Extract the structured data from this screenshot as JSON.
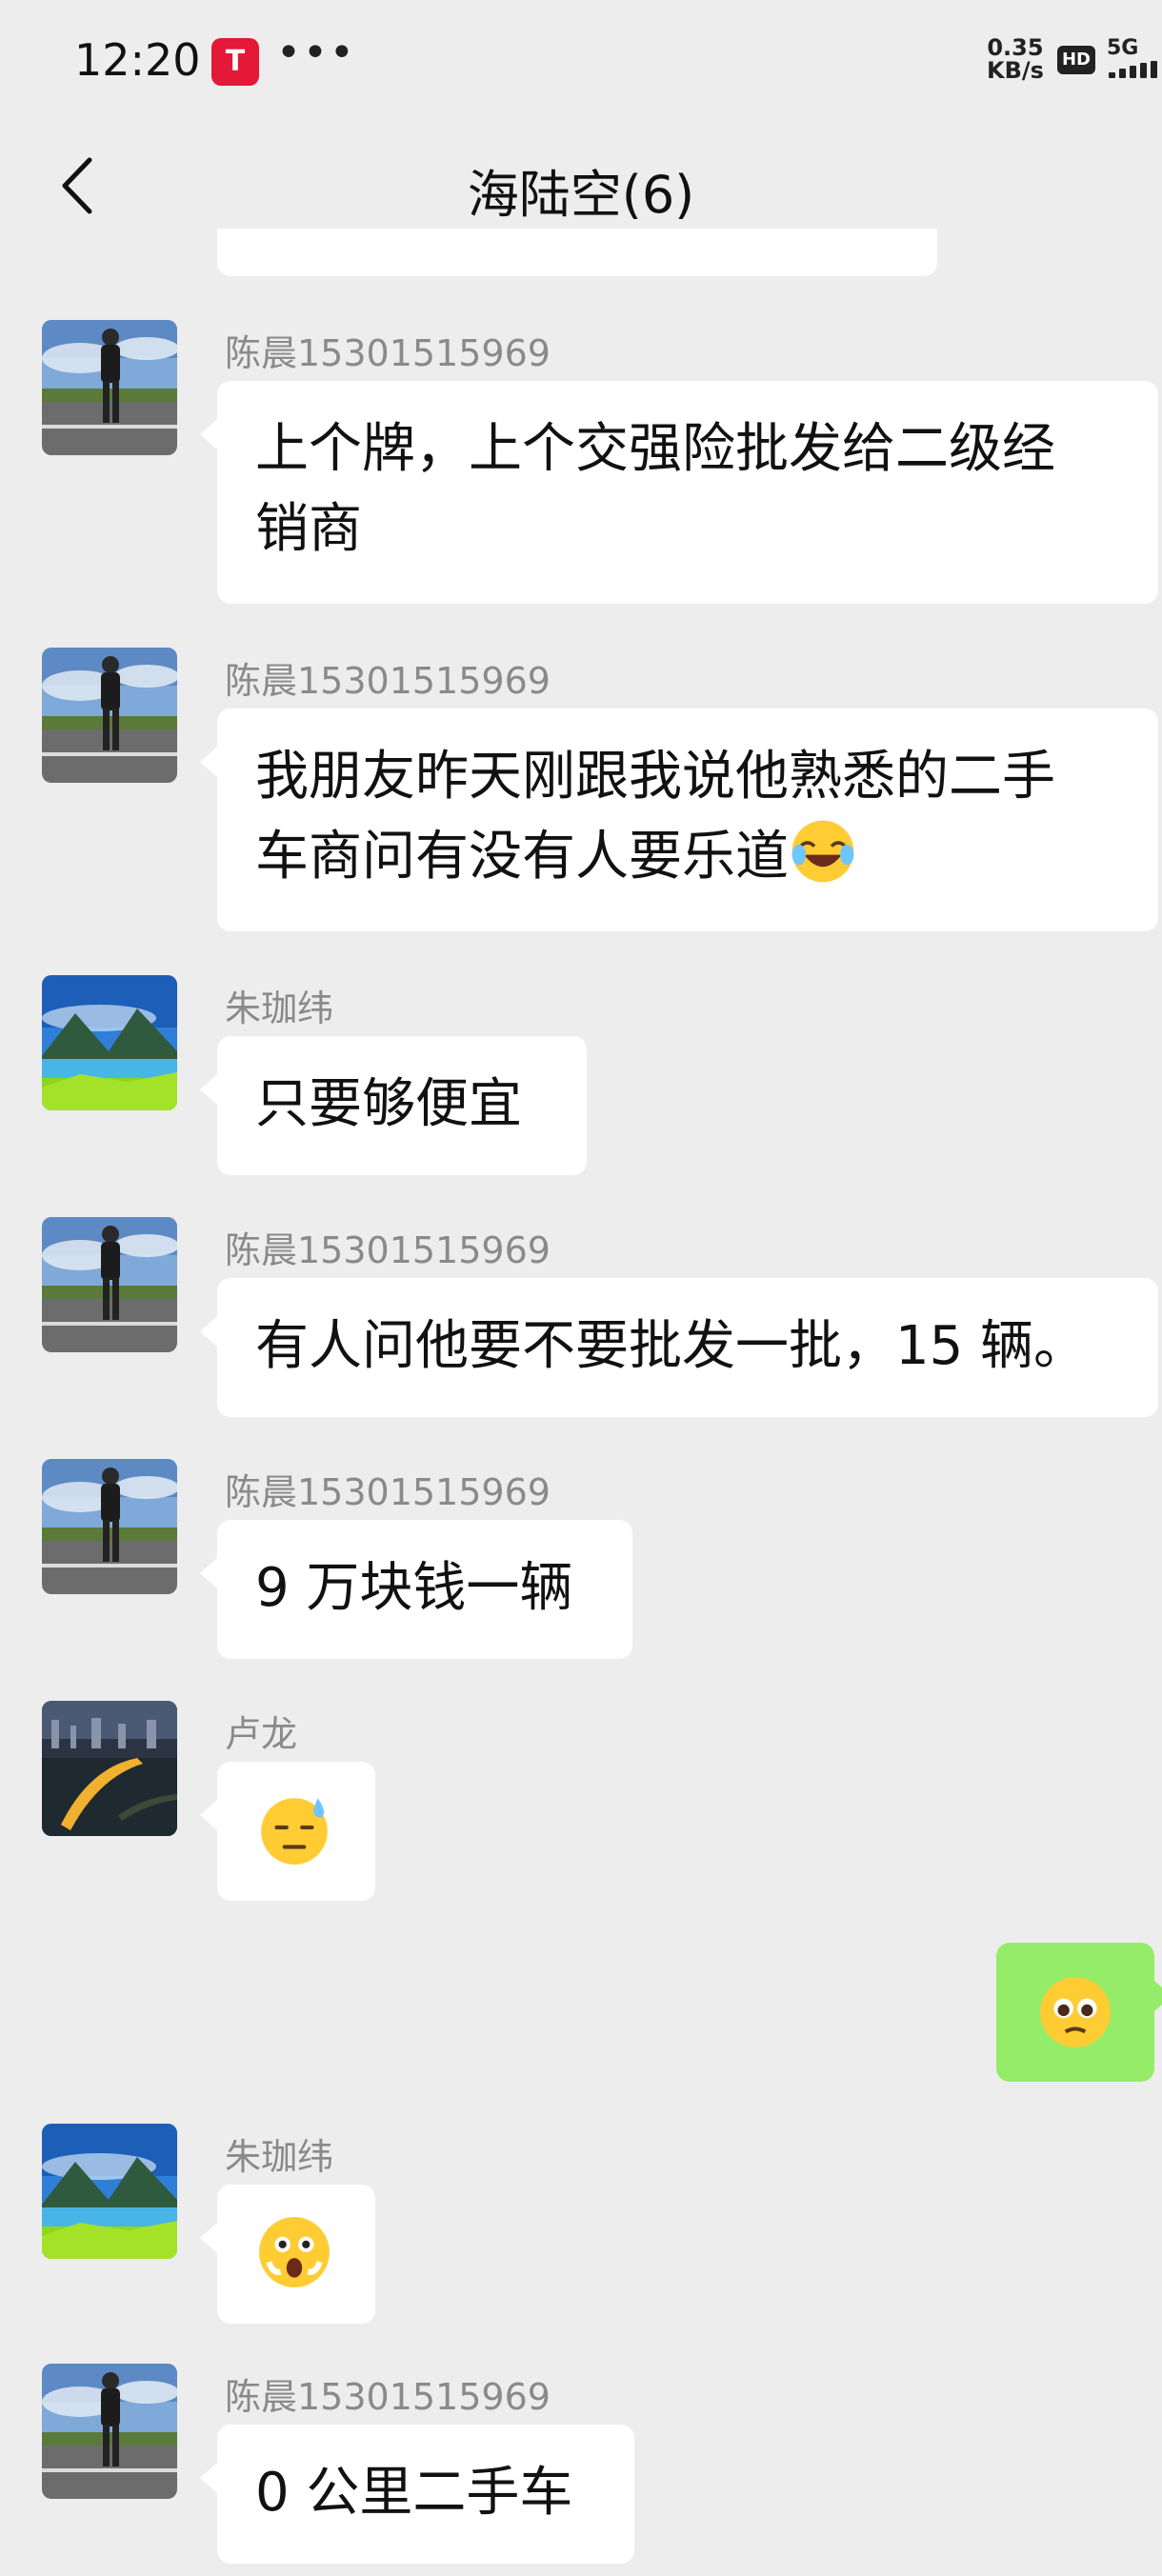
{
  "status_bar": {
    "time": "12:20",
    "app_badge": "T",
    "more": "•••",
    "net_speed_value": "0.35",
    "net_speed_unit": "KB/s",
    "hd": "HD",
    "network": "5G"
  },
  "header": {
    "title": "海陆空(6)"
  },
  "messages": [
    {
      "sender": "陈晨15301515969",
      "line1": "上个牌，上个交强险批发给二级经",
      "line2": "销商",
      "avatar": "person-on-road"
    },
    {
      "sender": "陈晨15301515969",
      "line1": "我朋友昨天刚跟我说他熟悉的二手",
      "line2": "车商问有没有人要乐道",
      "emoji": "rolling-on-floor-laughing",
      "avatar": "person-on-road"
    },
    {
      "sender": "朱珈纬",
      "text": "只要够便宜",
      "avatar": "lake-landscape"
    },
    {
      "sender": "陈晨15301515969",
      "text": "有人问他要不要批发一批，15 辆。",
      "avatar": "person-on-road"
    },
    {
      "sender": "陈晨15301515969",
      "text": "9 万块钱一辆",
      "avatar": "person-on-road"
    },
    {
      "sender": "卢龙",
      "emoji": "sweat-face",
      "avatar": "city-night"
    },
    {
      "sender": "me",
      "emoji": "pleading-face"
    },
    {
      "sender": "朱珈纬",
      "emoji": "shocked-face",
      "avatar": "lake-landscape"
    },
    {
      "sender": "陈晨15301515969",
      "text": "0 公里二手车",
      "avatar": "person-on-road"
    }
  ],
  "colors": {
    "background": "#ededed",
    "incoming_bubble": "#ffffff",
    "outgoing_bubble": "#95ec69",
    "sender_name": "#8a8a8a",
    "app_badge": "#e31937"
  }
}
